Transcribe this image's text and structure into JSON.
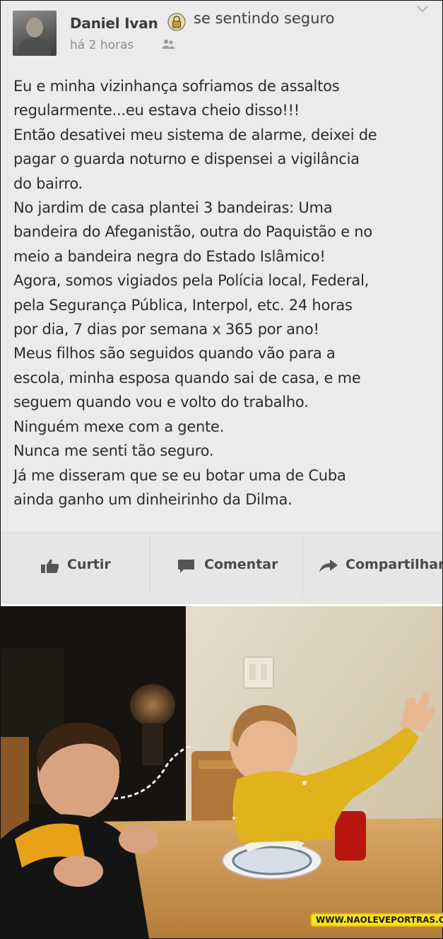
{
  "post": {
    "author": "Daniel Ivan",
    "feeling": "se sentindo seguro",
    "time": "há 2 horas",
    "icons": {
      "feeling": "lock-icon",
      "audience": "friends-icon",
      "menu": "chevron-down-icon"
    },
    "lines": [
      "Eu e minha vizinhança sofriamos de assaltos",
      "regularmente...eu estava cheio disso!!!",
      "Então desativei meu sistema de alarme, deixei de",
      "pagar o guarda noturno e dispensei a vigilância",
      "do bairro.",
      "No jardim de casa plantei 3 bandeiras: Uma",
      "bandeira do Afeganistão, outra do Paquistão e no",
      "meio a bandeira negra do Estado Islâmico!",
      "Agora, somos vigiados pela Polícia local, Federal,",
      "pela Segurança Pública, Interpol, etc. 24 horas",
      "por dia, 7 dias por semana x 365 por ano!",
      "Meus filhos são seguidos quando vão para a",
      "escola, minha esposa quando sai de casa, e me",
      "seguem quando vou e volto do trabalho.",
      "Ninguém mexe com a gente.",
      "Nunca me senti tão seguro.",
      "Já me disseram que se eu botar uma de Cuba",
      "ainda ganho um dinheirinho da Dilma."
    ],
    "actions": {
      "like": "Curtir",
      "comment": "Comentar",
      "share": "Compartilhar"
    }
  },
  "photo": {
    "subject": "two children laughing at a table, one spitting drink",
    "watermark": "WWW.NAOLEVEPORTRAS.COM"
  },
  "colors": {
    "post_background": "#ebebeb",
    "text": "#2c2c2c",
    "watermark_bg": "#f5e41c"
  }
}
